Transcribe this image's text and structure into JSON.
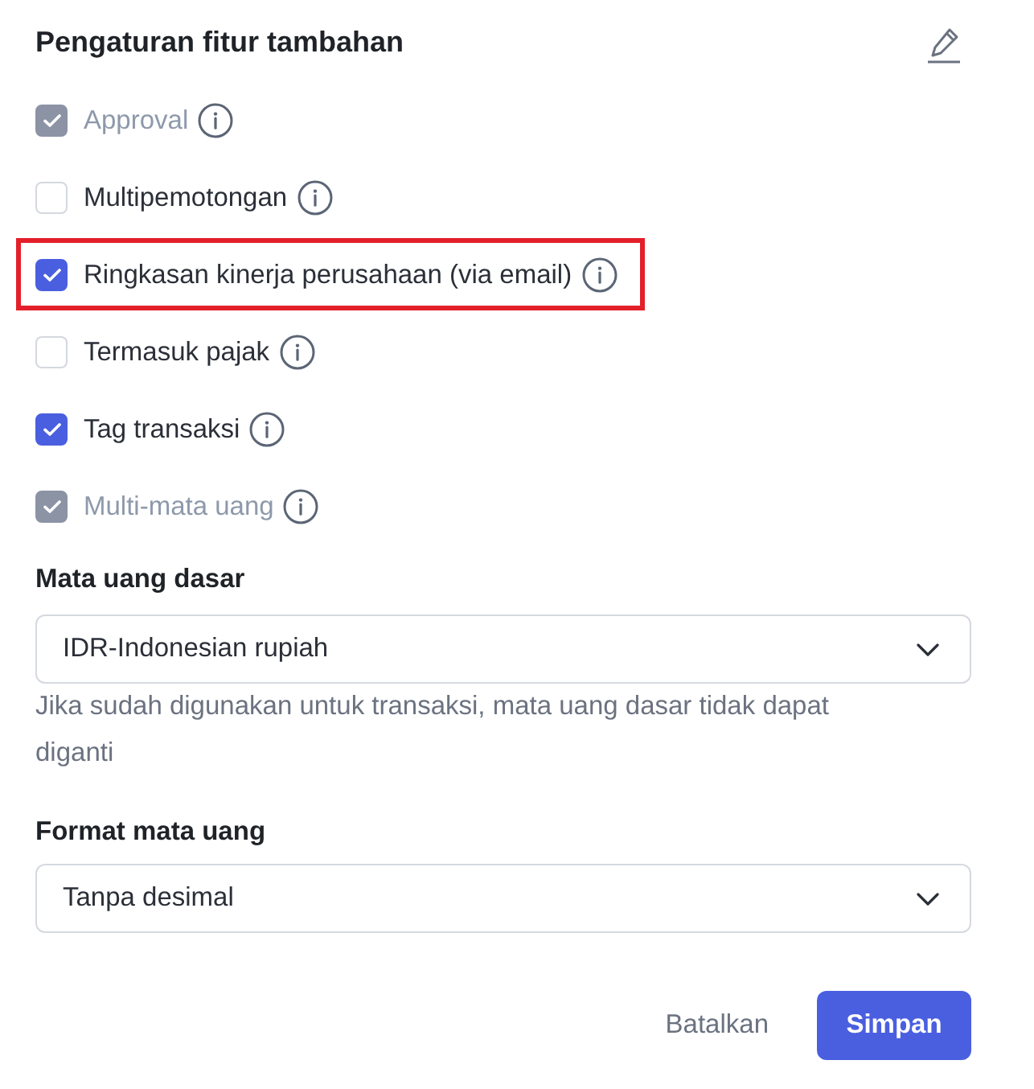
{
  "title": "Pengaturan fitur tambahan",
  "options": [
    {
      "label": "Approval",
      "checked": true,
      "disabled": true,
      "highlighted": false
    },
    {
      "label": "Multipemotongan",
      "checked": false,
      "disabled": false,
      "highlighted": false
    },
    {
      "label": "Ringkasan kinerja perusahaan (via email)",
      "checked": true,
      "disabled": false,
      "highlighted": true
    },
    {
      "label": "Termasuk pajak",
      "checked": false,
      "disabled": false,
      "highlighted": false
    },
    {
      "label": "Tag transaksi",
      "checked": true,
      "disabled": false,
      "highlighted": false
    },
    {
      "label": "Multi-mata uang",
      "checked": true,
      "disabled": true,
      "highlighted": false
    }
  ],
  "base_currency": {
    "label": "Mata uang dasar",
    "value": "IDR-Indonesian rupiah",
    "helper": "Jika sudah digunakan untuk transaksi, mata uang dasar tidak dapat diganti"
  },
  "currency_format": {
    "label": "Format mata uang",
    "value": "Tanpa desimal"
  },
  "buttons": [
    {
      "label": "Batalkan",
      "kind": "secondary"
    },
    {
      "label": "Simpan",
      "kind": "primary"
    }
  ]
}
